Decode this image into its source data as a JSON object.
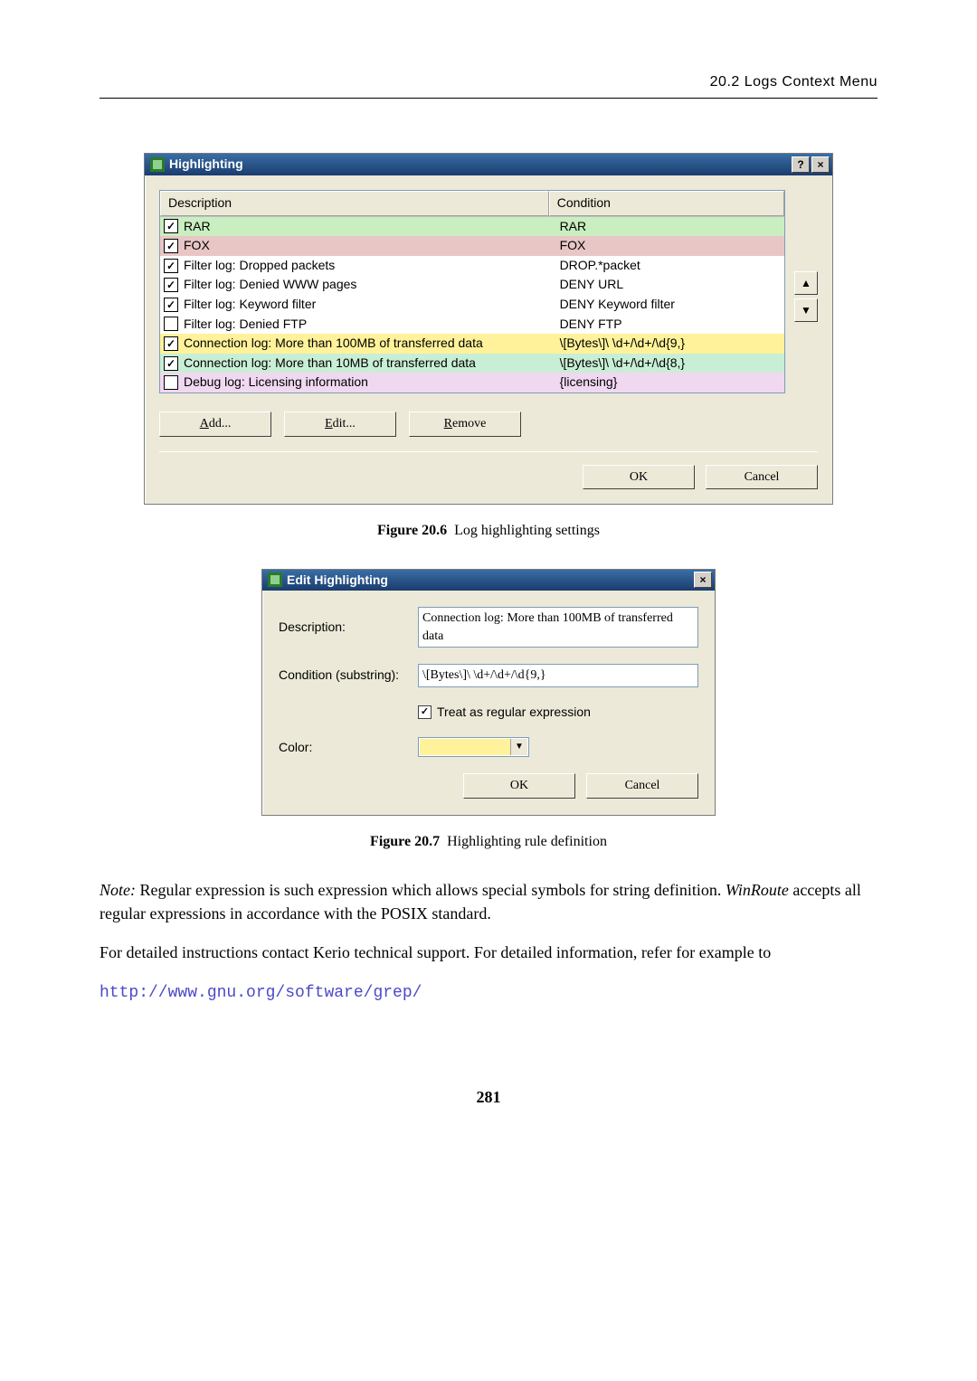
{
  "header": {
    "section": "20.2  Logs Context Menu"
  },
  "dialog1": {
    "title": "Highlighting",
    "help": "?",
    "close": "×",
    "columns": {
      "desc": "Description",
      "cond": "Condition"
    },
    "rows": [
      {
        "checked": true,
        "desc": "RAR",
        "cond": "RAR",
        "bg": "#c9eec0"
      },
      {
        "checked": true,
        "desc": "FOX",
        "cond": "FOX",
        "bg": "#e9c6c6"
      },
      {
        "checked": true,
        "desc": "Filter log: Dropped packets",
        "cond": "DROP.*packet",
        "bg": "#ffffff"
      },
      {
        "checked": true,
        "desc": "Filter log: Denied WWW pages",
        "cond": "DENY URL",
        "bg": "#ffffff"
      },
      {
        "checked": true,
        "desc": "Filter log: Keyword filter",
        "cond": "DENY Keyword filter",
        "bg": "#ffffff"
      },
      {
        "checked": false,
        "desc": "Filter log: Denied FTP",
        "cond": "DENY FTP",
        "bg": "#ffffff"
      },
      {
        "checked": true,
        "desc": "Connection log: More than 100MB of transferred data",
        "cond": "\\[Bytes\\]\\ \\d+/\\d+/\\d{9,}",
        "bg": "#fff29a"
      },
      {
        "checked": true,
        "desc": "Connection log: More than 10MB of transferred data",
        "cond": "\\[Bytes\\]\\ \\d+/\\d+/\\d{8,}",
        "bg": "#c9eed6"
      },
      {
        "checked": false,
        "desc": "Debug log: Licensing information",
        "cond": "{licensing}",
        "bg": "#f0d8f0"
      }
    ],
    "arrows": {
      "up": "▲",
      "down": "▼"
    },
    "buttons": {
      "add": "Add...",
      "edit": "Edit...",
      "remove": "Remove",
      "ok": "OK",
      "cancel": "Cancel"
    }
  },
  "fig1": {
    "label": "Figure 20.6",
    "caption": "Log highlighting settings"
  },
  "dialog2": {
    "title": "Edit Highlighting",
    "close": "×",
    "labels": {
      "desc": "Description:",
      "cond": "Condition (substring):",
      "regex": "Treat as regular expression",
      "color": "Color:"
    },
    "values": {
      "desc": "Connection log: More than 100MB of transferred data",
      "cond": "\\[Bytes\\]\\ \\d+/\\d+/\\d{9,}"
    },
    "regex_checked": true,
    "buttons": {
      "ok": "OK",
      "cancel": "Cancel"
    }
  },
  "fig2": {
    "label": "Figure 20.7",
    "caption": "Highlighting rule definition"
  },
  "note": {
    "lead": "Note:",
    "p1": " Regular expression is such expression which allows special symbols for string definition. ",
    "em": "WinRoute",
    "p1b": " accepts all regular expressions in accordance with the POSIX standard.",
    "p2": "For detailed instructions contact Kerio technical support. For detailed information, refer for example to",
    "url": "http://www.gnu.org/software/grep/"
  },
  "page_number": "281"
}
